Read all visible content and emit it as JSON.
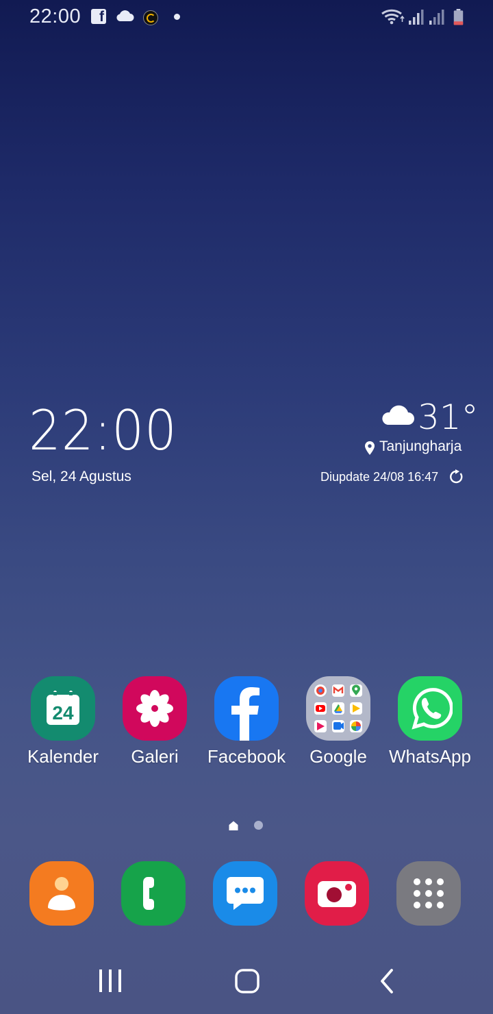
{
  "status_bar": {
    "time": "22:00",
    "notification_icons": [
      "facebook-icon",
      "cloud-icon",
      "game-icon",
      "dot-icon"
    ],
    "system_icons": [
      "wifi-icon",
      "signal-icon",
      "signal-icon",
      "battery-icon"
    ]
  },
  "clock_widget": {
    "time": "22:00",
    "date": "Sel, 24 Agustus"
  },
  "weather_widget": {
    "temperature": "31°",
    "location": "Tanjungharja",
    "updated": "Diupdate 24/08 16:47",
    "icon": "cloud-icon"
  },
  "home_apps": [
    {
      "label": "Kalender",
      "icon": "calendar-icon",
      "color": "#138b6f",
      "calendar_day": "24"
    },
    {
      "label": "Galeri",
      "icon": "flower-icon",
      "color": "#d1085c"
    },
    {
      "label": "Facebook",
      "icon": "facebook-icon",
      "color": "#1877f2"
    },
    {
      "label": "Google",
      "icon": "folder-icon",
      "color": "#b3b8c9"
    },
    {
      "label": "WhatsApp",
      "icon": "whatsapp-icon",
      "color": "#25d366"
    }
  ],
  "page_indicator": {
    "pages": 2,
    "current_page": "home"
  },
  "dock_apps": [
    {
      "icon": "contacts-icon",
      "color": "#f47b20"
    },
    {
      "icon": "phone-icon",
      "color": "#16a34a"
    },
    {
      "icon": "messages-icon",
      "color": "#1a8be8"
    },
    {
      "icon": "camera-icon",
      "color": "#e11d48"
    },
    {
      "icon": "apps-grid-icon",
      "color": "#7a7a80"
    }
  ],
  "nav_bar": {
    "buttons": [
      "recent-apps-icon",
      "home-icon",
      "back-icon"
    ]
  }
}
